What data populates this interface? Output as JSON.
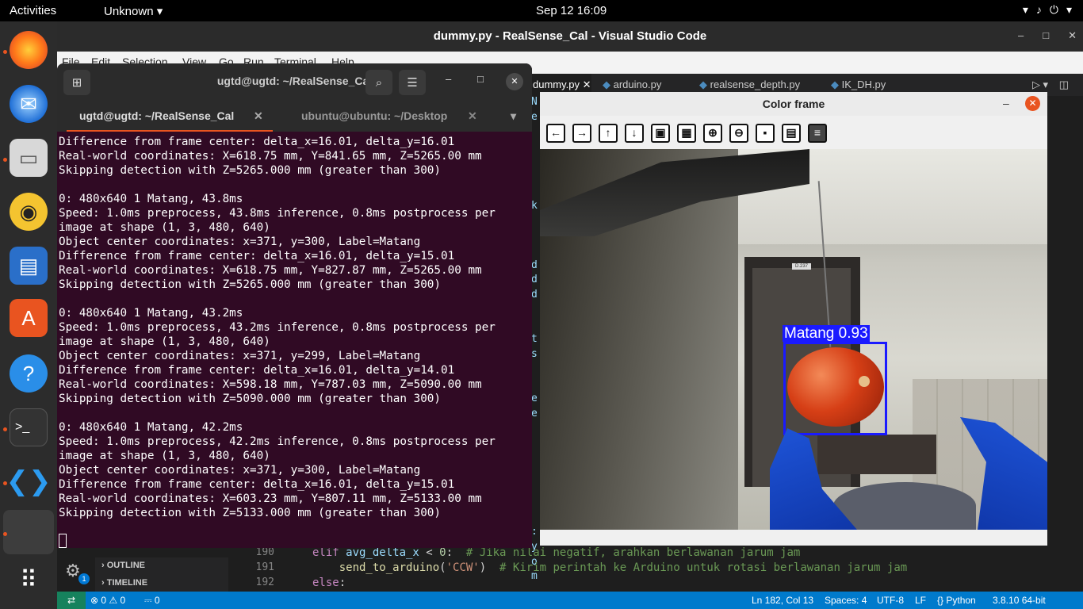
{
  "topbar": {
    "activities": "Activities",
    "app_menu": "Unknown",
    "clock": "Sep 12  16:09"
  },
  "dock": {
    "items": [
      "firefox-icon",
      "thunderbird-icon",
      "files-icon",
      "rhythmbox-icon",
      "libreoffice-writer-icon",
      "software-center-icon",
      "help-icon",
      "terminal-icon",
      "vscode-icon",
      "blank-window",
      "show-apps-icon"
    ]
  },
  "vscode": {
    "title": "dummy.py - RealSense_Cal - Visual Studio Code",
    "menu": [
      "File",
      "Edit",
      "Selection",
      "View",
      "Go",
      "Run",
      "Terminal",
      "Help"
    ],
    "tabs": [
      "dummy.py",
      "arduino.py",
      "realsense_depth.py",
      "IK_DH.py"
    ],
    "editor_strip_letters": [
      {
        "ch": "N",
        "line": 0
      },
      {
        "ch": "e",
        "line": 1
      },
      {
        "ch": "k",
        "line": 7
      },
      {
        "ch": "d",
        "line": 11
      },
      {
        "ch": "d",
        "line": 12
      },
      {
        "ch": "d",
        "line": 13
      },
      {
        "ch": "t",
        "line": 16
      },
      {
        "ch": "s",
        "line": 17
      },
      {
        "ch": "e",
        "line": 20
      },
      {
        "ch": "e",
        "line": 21
      },
      {
        "ch": ":",
        "line": 29
      },
      {
        "ch": "y",
        "line": 30
      },
      {
        "ch": "o",
        "line": 31
      },
      {
        "ch": "m",
        "line": 32
      },
      {
        "ch": "i",
        "line": 34
      }
    ],
    "outline_label": "OUTLINE",
    "timeline_label": "TIMELINE",
    "gear_badge": "1",
    "line_numbers": [
      "190",
      "191",
      "192"
    ],
    "code_lines": {
      "l190_kw": "elif",
      "l190_var": " avg_delta_x",
      "l190_rest": " < ",
      "l190_num": "0",
      "l190_colon": ":  ",
      "l190_comment": "# Jika nilai negatif, arahkan berlawanan jarum jam",
      "l191_fn": "    send_to_arduino",
      "l191_open": "(",
      "l191_str": "'CCW'",
      "l191_close": ")  ",
      "l191_comment": "# Kirim perintah ke Arduino untuk rotasi berlawanan jarum jam",
      "l192_kw": "else",
      "l192_colon": ":"
    },
    "status": {
      "errors": "⊗ 0 ⚠ 0",
      "ports": "⎓ 0",
      "position": "Ln 182, Col 13",
      "spaces": "Spaces: 4",
      "encoding": "UTF-8",
      "eol": "LF",
      "language": "{} Python",
      "interpreter": "3.8.10 64-bit"
    }
  },
  "terminal": {
    "title": "ugtd@ugtd: ~/RealSense_Cal",
    "tabs": [
      {
        "label": "ugtd@ugtd: ~/RealSense_Cal",
        "active": true
      },
      {
        "label": "ubuntu@ubuntu: ~/Desktop",
        "active": false
      }
    ],
    "output": "Difference from frame center: delta_x=16.01, delta_y=16.01\nReal-world coordinates: X=618.75 mm, Y=841.65 mm, Z=5265.00 mm\nSkipping detection with Z=5265.000 mm (greater than 300)\n\n0: 480x640 1 Matang, 43.8ms\nSpeed: 1.0ms preprocess, 43.8ms inference, 0.8ms postprocess per\nimage at shape (1, 3, 480, 640)\nObject center coordinates: x=371, y=300, Label=Matang\nDifference from frame center: delta_x=16.01, delta_y=15.01\nReal-world coordinates: X=618.75 mm, Y=827.87 mm, Z=5265.00 mm\nSkipping detection with Z=5265.000 mm (greater than 300)\n\n0: 480x640 1 Matang, 43.2ms\nSpeed: 1.0ms preprocess, 43.2ms inference, 0.8ms postprocess per\nimage at shape (1, 3, 480, 640)\nObject center coordinates: x=371, y=299, Label=Matang\nDifference from frame center: delta_x=16.01, delta_y=14.01\nReal-world coordinates: X=598.18 mm, Y=787.03 mm, Z=5090.00 mm\nSkipping detection with Z=5090.000 mm (greater than 300)\n\n0: 480x640 1 Matang, 42.2ms\nSpeed: 1.0ms preprocess, 42.2ms inference, 0.8ms postprocess per\nimage at shape (1, 3, 480, 640)\nObject center coordinates: x=371, y=300, Label=Matang\nDifference from frame center: delta_x=16.01, delta_y=15.01\nReal-world coordinates: X=603.23 mm, Y=807.11 mm, Z=5133.00 mm\nSkipping detection with Z=5133.000 mm (greater than 300)"
  },
  "color_frame": {
    "title": "Color frame",
    "toolbar": [
      "back-arrow",
      "forward-arrow",
      "up-arrow",
      "down-arrow",
      "image",
      "image-settings",
      "zoom-in",
      "zoom-out",
      "save",
      "clipboard",
      "properties"
    ],
    "detection": {
      "label": "Matang 0.93",
      "box_color": "#1a1aff"
    },
    "door_sign": "D.237"
  },
  "colors": {
    "accent": "#e95420",
    "vscode_blue": "#007acc",
    "terminal_bg": "#300a24"
  }
}
